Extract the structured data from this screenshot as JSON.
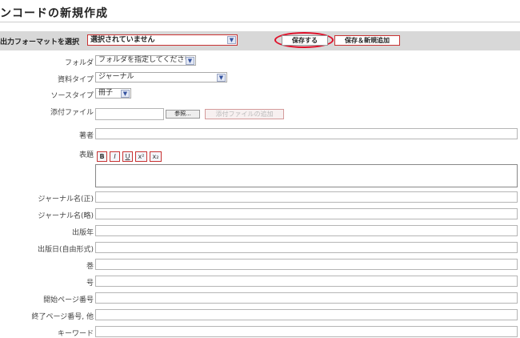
{
  "page": {
    "title": "ンコードの新規作成"
  },
  "toolbar": {
    "format_label": "出力フォーマットを選択",
    "format_value": "選択されていません",
    "save_label": "保存する",
    "save_add_label": "保存＆新規追加"
  },
  "icons": {
    "dropdown": "▼"
  },
  "form": {
    "folder_label": "フォルダ",
    "folder_value": "フォルダを指定してください",
    "doc_type_label": "資料タイプ",
    "doc_type_value": "ジャーナル",
    "source_type_label": "ソースタイプ",
    "source_type_value": "冊子",
    "attach_label": "添付ファイル",
    "browse_label": "参照...",
    "add_file_label": "添付ファイルの追加",
    "author_label": "著者",
    "title_label": "表題",
    "format_buttons": {
      "bold": "B",
      "italic": "I",
      "underline": "U",
      "sup": "x²",
      "sub": "x₂"
    },
    "journal_formal_label": "ジャーナル名(正)",
    "journal_abbr_label": "ジャーナル名(略)",
    "pub_year_label": "出版年",
    "pub_date_label": "出版日(自由形式)",
    "volume_label": "巻",
    "issue_label": "号",
    "start_page_label": "開始ページ番号",
    "end_page_label": "終了ページ番号, 他",
    "keyword_label": "キーワード"
  }
}
